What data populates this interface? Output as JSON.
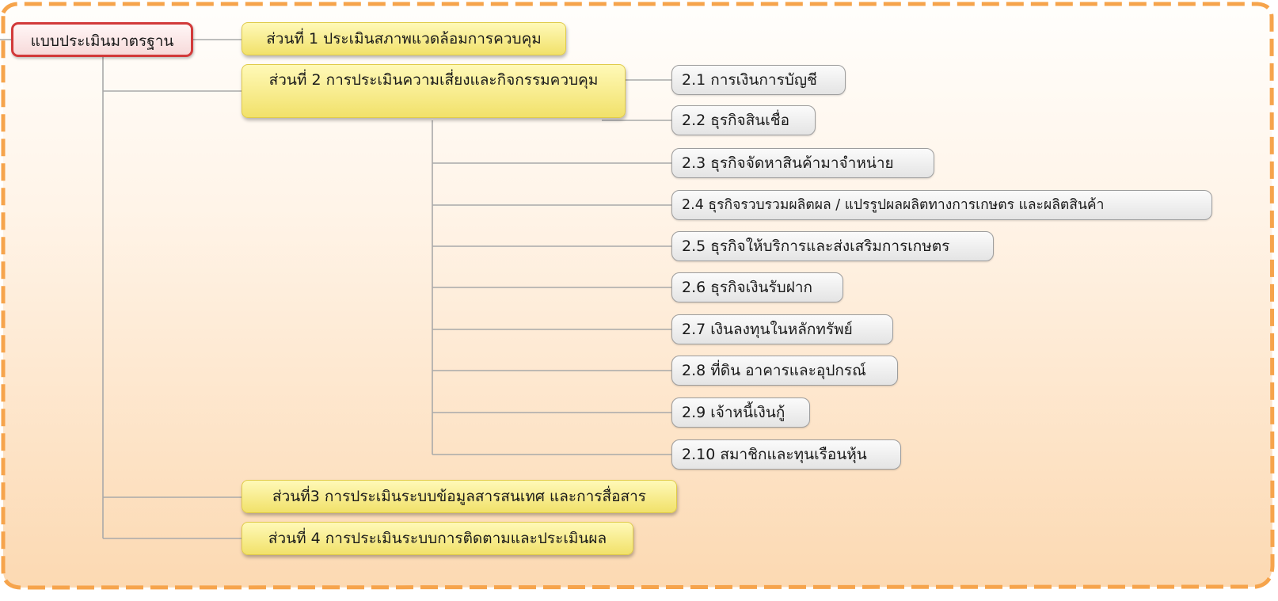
{
  "mindmap": {
    "root": {
      "label": "แบบประเมินมาตรฐาน"
    },
    "sections": [
      {
        "label": "ส่วนที่ 1 ประเมินสภาพแวดล้อมการควบคุม"
      },
      {
        "label": "ส่วนที่ 2 การประเมินความเสี่ยงและกิจกรรมควบคุม"
      },
      {
        "label": "ส่วนที่3 การประเมินระบบข้อมูลสารสนเทศ และการสื่อสาร"
      },
      {
        "label": "ส่วนที่ 4 การประเมินระบบการติดตามและประเมินผล"
      }
    ],
    "subtopics": [
      {
        "label": "2.1 การเงินการบัญชี"
      },
      {
        "label": "2.2 ธุรกิจสินเชื่อ"
      },
      {
        "label": "2.3 ธุรกิจจัดหาสินค้ามาจำหน่าย"
      },
      {
        "label": "2.4 ธุรกิจรวบรวมผลิตผล / แปรรูปผลผลิตทางการเกษตร และผลิตสินค้า"
      },
      {
        "label": "2.5 ธุรกิจให้บริการและส่งเสริมการเกษตร"
      },
      {
        "label": "2.6 ธุรกิจเงินรับฝาก"
      },
      {
        "label": "2.7 เงินลงทุนในหลักทรัพย์"
      },
      {
        "label": "2.8 ที่ดิน อาคารและอุปกรณ์"
      },
      {
        "label": "2.9 เจ้าหนี้เงินกู้"
      },
      {
        "label": "2.10 สมาชิกและทุนเรือนหุ้น"
      }
    ]
  },
  "colors": {
    "border_dash": "#f6a44c",
    "background_top": "#fffdfa",
    "background_bottom": "#fcdcb8",
    "root_border": "#d23a3a",
    "section_fill": "#f4e77a",
    "subtopic_fill": "#eeeeee",
    "connector": "#a9a9a9"
  }
}
